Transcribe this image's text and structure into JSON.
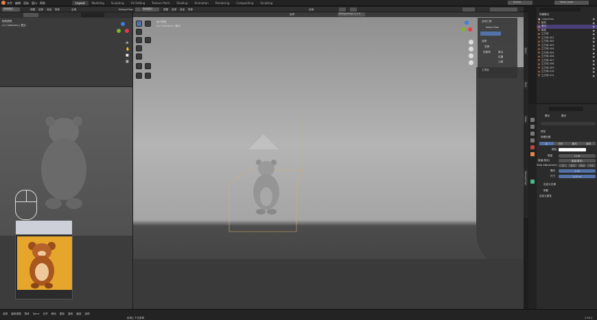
{
  "topbar": {
    "menus": [
      "文件",
      "编辑",
      "渲染",
      "窗口",
      "帮助"
    ],
    "workspaces": [
      "Layout",
      "Modeling",
      "Sculpting",
      "UV Editing",
      "Texture Paint",
      "Shading",
      "Animation",
      "Rendering",
      "Compositing",
      "Scripting"
    ],
    "active_workspace": "Layout",
    "scene": "Scene",
    "view_layer": "View Layer"
  },
  "left_viewport": {
    "mode": "物体模式",
    "menus": [
      "视图",
      "选择",
      "添加",
      "物体"
    ],
    "transform": "全局",
    "info_title": "相机透视",
    "info_sub": "(1) Collection | 叠光",
    "header_right": "RetopoFlow"
  },
  "main_viewport": {
    "mode": "物体模式",
    "menus": [
      "视图",
      "选择",
      "添加",
      "物体"
    ],
    "transform": "全局",
    "info_title": "用户透视",
    "info_sub": "(1) Collection | 叠光",
    "retopo": "RetopoFlow 3.1.0",
    "options": "选项"
  },
  "npanel": {
    "active_tool_title": "活动工具",
    "select_box": "Select Box",
    "options_title": "选项",
    "transform_title": "变换",
    "affect_only": "仅影响",
    "origin": "原点",
    "location": "位置",
    "parent": "父级",
    "workspace": "工作区"
  },
  "side_tabs": [
    "Item",
    "Tool",
    "View",
    "RetopoFlow"
  ],
  "outliner": {
    "title": "场景集合",
    "items": [
      {
        "name": "Collection",
        "icon": "collection-icon"
      },
      {
        "name": "相机",
        "icon": "camera-icon"
      },
      {
        "name": "叠光",
        "icon": "light-icon"
      },
      {
        "name": "柳枝",
        "icon": "object-icon"
      },
      {
        "name": "立方体",
        "icon": "mesh-icon"
      },
      {
        "name": "立方体.001",
        "icon": "mesh-icon"
      },
      {
        "name": "立方体.002",
        "icon": "mesh-icon"
      },
      {
        "name": "立方体.003",
        "icon": "mesh-icon"
      },
      {
        "name": "立方体.004",
        "icon": "mesh-icon"
      },
      {
        "name": "立方体.005",
        "icon": "mesh-icon"
      },
      {
        "name": "立方体.006",
        "icon": "mesh-icon"
      },
      {
        "name": "立方体.007",
        "icon": "mesh-icon"
      },
      {
        "name": "立方体.008",
        "icon": "mesh-icon"
      },
      {
        "name": "立方体.009",
        "icon": "mesh-icon"
      },
      {
        "name": "立方体.010",
        "icon": "mesh-icon"
      },
      {
        "name": "立方体.011",
        "icon": "mesh-icon"
      }
    ]
  },
  "properties": {
    "object_name": "叠光",
    "data_name": "叠光",
    "preview": "预览",
    "light_props": "物理光照",
    "light_types": [
      "点",
      "日光",
      "聚光",
      "面光"
    ],
    "color_label": "颜色",
    "power_label": "能量",
    "power_value": "10 W",
    "power_ratio_label": "能量(乘法)",
    "power_ratio_value": "能量(乘法)",
    "step_adj_label": "Step Adjustment",
    "step_values": [
      "-1",
      "-0.1",
      "+0.1",
      "+1"
    ],
    "exposure_label": "曝光",
    "exposure_value": "1.00",
    "size_label": "尺寸",
    "size_value": "0.25 m",
    "custom_light": "自定义光源",
    "shadow_label": "阴影",
    "custom_props": "自定义属性"
  },
  "statusbar": {
    "items": [
      "选择",
      "旋转视图",
      "物体",
      "Spice",
      "对齐",
      "移动",
      "图标",
      "旋转",
      "缩放",
      "选项"
    ],
    "hint": "区域上下文菜单",
    "version": "2.93.1"
  },
  "colors": {
    "accent": "#5372a8",
    "orange": "#e7834a",
    "bg": "#1d1d1d"
  }
}
